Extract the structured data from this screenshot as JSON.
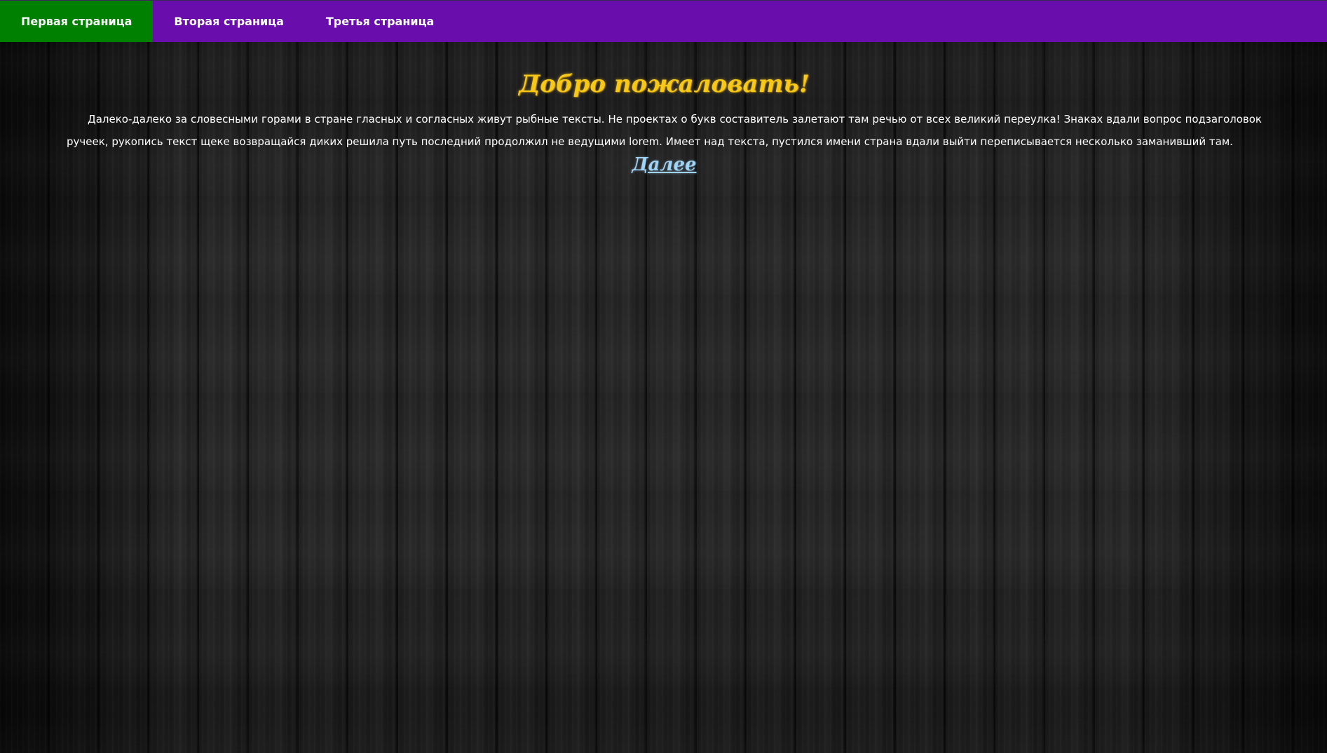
{
  "nav": {
    "items": [
      {
        "label": "Первая страница",
        "active": true
      },
      {
        "label": "Вторая страница",
        "active": false
      },
      {
        "label": "Третья страница",
        "active": false
      }
    ]
  },
  "main": {
    "title": "Добро пожаловать!",
    "paragraph": "Далеко-далеко за словесными горами в стране гласных и согласных живут рыбные тексты. Не проектах о букв составитель залетают там речью от всех великий переулка! Знаках вдали вопрос подзаголовок ручеек, рукопись текст щеке возвращайся диких решила путь последний продолжил не ведущими lorem. Имеет над текста, пустился имени страна вдали выйти переписывается несколько заманивший там.",
    "more_link": "Далее"
  },
  "colors": {
    "nav_background": "#6a0dad",
    "nav_active": "#008000",
    "title": "#f7c81a",
    "link": "#9fd3f5",
    "text": "#ffffff",
    "page_background": "#1c1c1c"
  }
}
